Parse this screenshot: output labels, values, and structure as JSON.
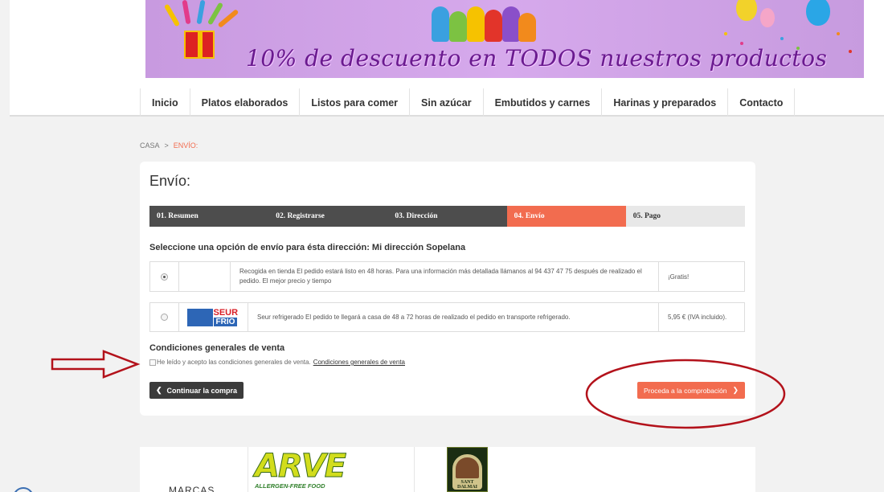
{
  "banner": {
    "text": "10% de descuento en TODOS nuestros productos"
  },
  "nav": {
    "items": [
      {
        "label": "Inicio"
      },
      {
        "label": "Platos elaborados"
      },
      {
        "label": "Listos para comer"
      },
      {
        "label": "Sin azúcar"
      },
      {
        "label": "Embutidos y carnes"
      },
      {
        "label": "Harinas y preparados"
      },
      {
        "label": "Contacto"
      }
    ]
  },
  "breadcrumb": {
    "home": "CASA",
    "separator": ">",
    "current": "ENVÍO:"
  },
  "page": {
    "title": "Envío:"
  },
  "steps": [
    {
      "label": "01. Resumen",
      "state": "done"
    },
    {
      "label": "02. Registrarse",
      "state": "done"
    },
    {
      "label": "03. Dirección",
      "state": "done"
    },
    {
      "label": "04. Envío",
      "state": "active"
    },
    {
      "label": "05. Pago",
      "state": "todo"
    }
  ],
  "shipping": {
    "prompt": "Seleccione una opción de envío para ésta dirección: Mi dirección Sopelana",
    "options": [
      {
        "selected": true,
        "description": "Recogida en tienda El pedido estará listo en 48 horas. Para una información más detallada llámanos al 94 437 47 75 después de realizado el pedido. El mejor precio y tiempo",
        "price": "¡Gratis!"
      },
      {
        "selected": false,
        "logo_text_1": "SEUR",
        "logo_text_2": "FRIO",
        "description": "Seur refrigerado El pedido te llegará a casa de 48 a 72 horas de realizado el pedido en transporte refrigerado.",
        "price": "5,95 € (IVA incluido)."
      }
    ]
  },
  "conditions": {
    "title": "Condiciones generales de venta",
    "checkbox_label": "He leído y acepto las condiciones generales de venta.",
    "link_label": "Condiciones generales de venta",
    "checked": false
  },
  "buttons": {
    "back_label": "Continuar la compra",
    "proceed_label": "Proceda a la comprobación"
  },
  "brands": {
    "label": "MARCAS",
    "arve_word": "ARVE",
    "arve_tagline": "ALLERGEN-FREE FOOD",
    "santdalmai_text": "SANT DALMAI"
  },
  "colors": {
    "accent": "#f26c4f",
    "dark_step": "#4d4d4d",
    "annotation": "#b3121b",
    "seur_blue": "#2d66b6"
  }
}
